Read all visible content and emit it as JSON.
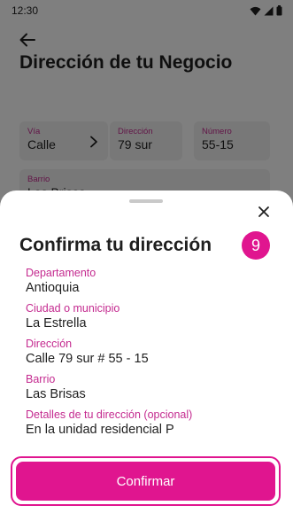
{
  "status_bar": {
    "time": "12:30"
  },
  "page": {
    "title": "Dirección de tu Negocio"
  },
  "form": {
    "via": {
      "label": "Vía",
      "value": "Calle"
    },
    "direccion": {
      "label": "Dirección",
      "value": "79 sur"
    },
    "numero": {
      "label": "Número",
      "value": "55-15"
    },
    "barrio": {
      "label": "Barrio",
      "value": "Las Brisas"
    }
  },
  "sheet": {
    "title": "Confirma tu dirección",
    "step": "9",
    "details": [
      {
        "label": "Departamento",
        "value": "Antioquia"
      },
      {
        "label": "Ciudad o municipio",
        "value": "La Estrella"
      },
      {
        "label": "Dirección",
        "value": "Calle 79 sur # 55 - 15"
      },
      {
        "label": "Barrio",
        "value": "Las Brisas"
      },
      {
        "label": "Detalles de tu dirección (opcional)",
        "value": "En la unidad residencial P"
      }
    ],
    "confirm_label": "Confirmar"
  },
  "colors": {
    "accent": "#e0158f",
    "label": "#c42a8f"
  }
}
